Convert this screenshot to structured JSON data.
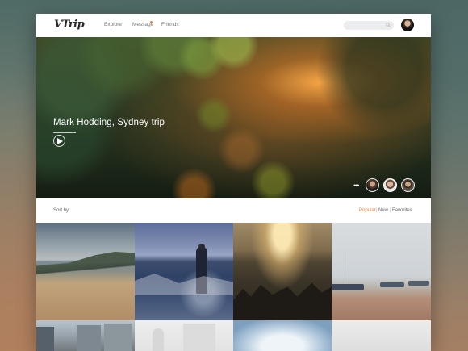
{
  "app": {
    "logo": "VTrip"
  },
  "nav": {
    "explore": "Explore",
    "message": "Message",
    "friends": "Friends"
  },
  "search": {
    "placeholder": ""
  },
  "hero": {
    "title": "Mark Hodding, Sydney trip"
  },
  "sort": {
    "label": "Sort by:",
    "options": [
      "Popular",
      "New",
      "Favorites"
    ],
    "separator": "|",
    "selected": "Popular"
  },
  "colors": {
    "accent": "#e8833a",
    "text": "#777777",
    "background": "#ffffff"
  },
  "icons": [
    "search-icon",
    "play-icon",
    "more-icon"
  ],
  "photos_visible": 8
}
